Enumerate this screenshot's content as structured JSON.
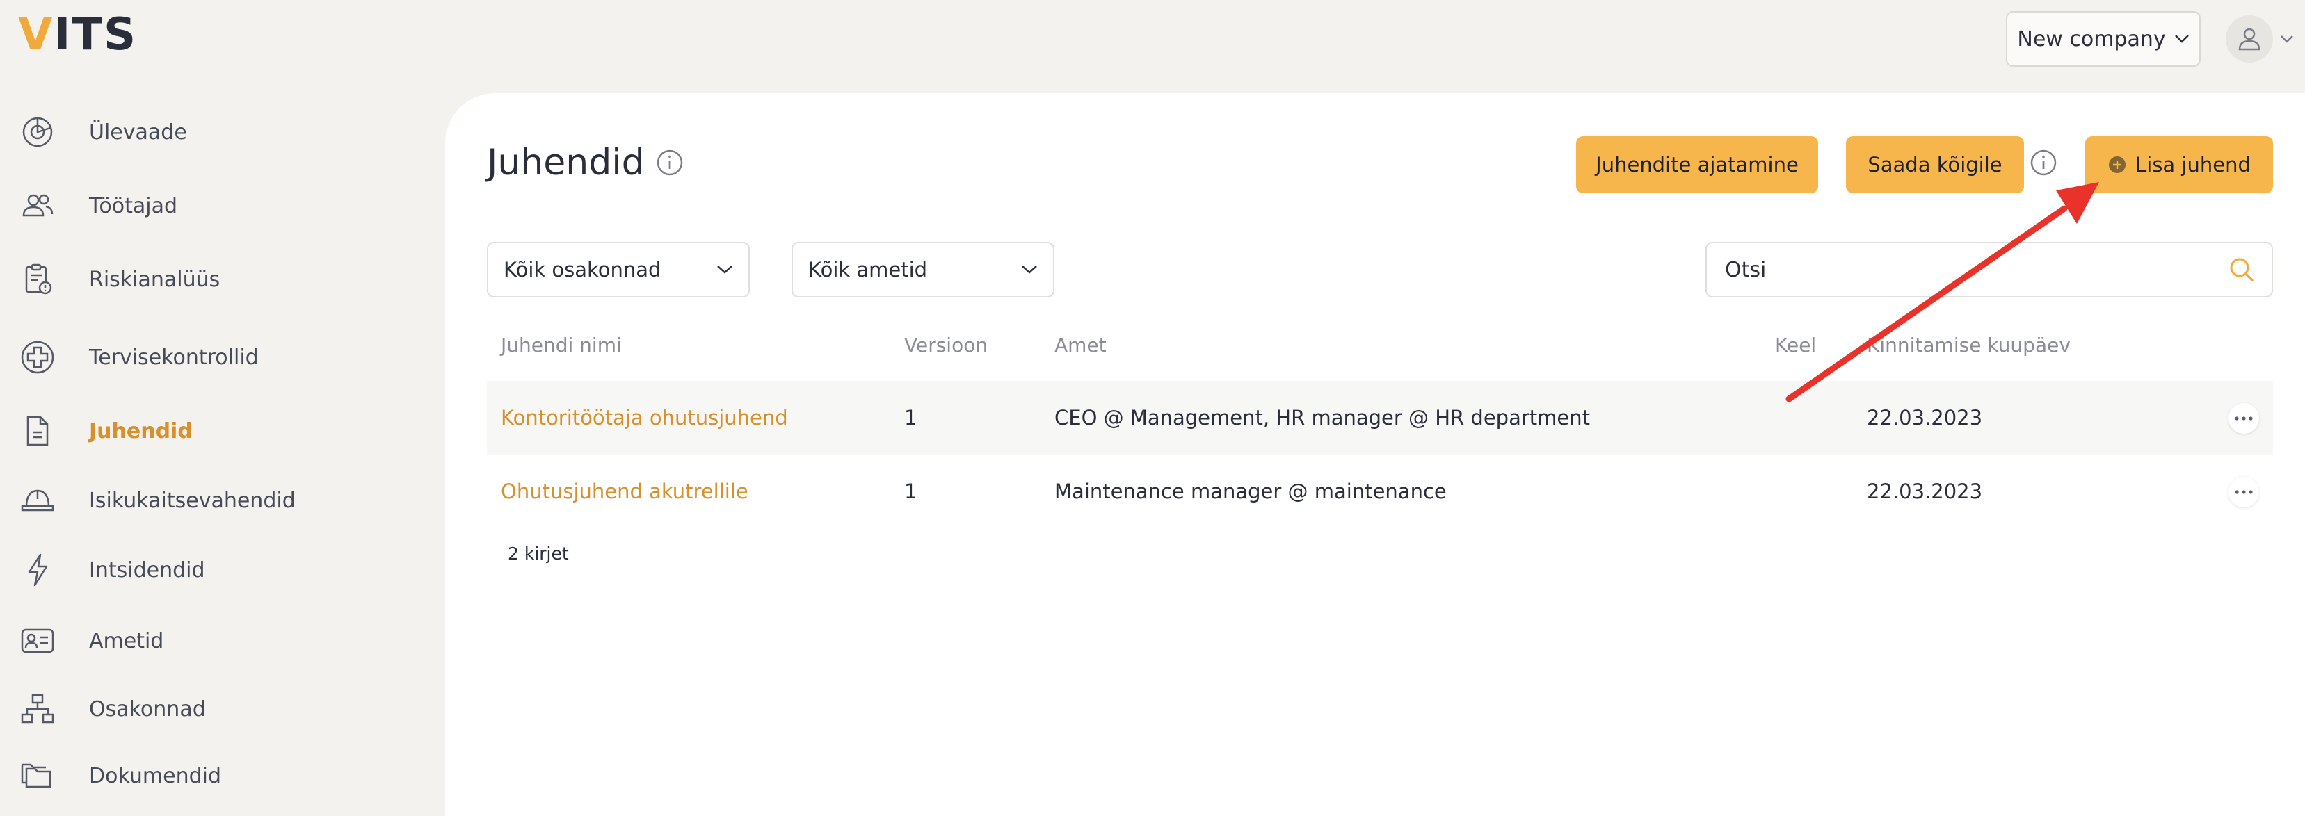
{
  "logo": {
    "accent": "V",
    "rest": "ITS"
  },
  "header": {
    "company": "New company"
  },
  "sidebar": {
    "items": [
      {
        "label": "Ülevaade",
        "icon": "chart-pie-icon"
      },
      {
        "label": "Töötajad",
        "icon": "users-icon"
      },
      {
        "label": "Riskianalüüs",
        "icon": "clipboard-alert-icon"
      },
      {
        "label": "Tervisekontrollid",
        "icon": "medical-cross-icon"
      },
      {
        "label": "Juhendid",
        "icon": "document-icon",
        "active": true
      },
      {
        "label": "Isikukaitsevahendid",
        "icon": "hard-hat-icon"
      },
      {
        "label": "Intsidendid",
        "icon": "lightning-icon"
      },
      {
        "label": "Ametid",
        "icon": "id-card-icon"
      },
      {
        "label": "Osakonnad",
        "icon": "org-chart-icon"
      },
      {
        "label": "Dokumendid",
        "icon": "folders-icon"
      }
    ]
  },
  "main": {
    "title": "Juhendid",
    "buttons": {
      "schedule": "Juhendite ajatamine",
      "send_all": "Saada kõigile",
      "add": "Lisa juhend"
    },
    "filters": {
      "departments": "Kõik osakonnad",
      "positions": "Kõik ametid"
    },
    "search": {
      "placeholder": "Otsi"
    },
    "table": {
      "headers": [
        "Juhendi nimi",
        "Versioon",
        "Amet",
        "Keel",
        "Kinnitamise kuupäev"
      ],
      "rows": [
        {
          "name": "Kontoritöötaja ohutusjuhend",
          "version": "1",
          "position": "CEO @ Management, HR manager @ HR department",
          "language": "",
          "date": "22.03.2023"
        },
        {
          "name": "Ohutusjuhend akutrellile",
          "version": "1",
          "position": "Maintenance manager @ maintenance",
          "language": "",
          "date": "22.03.2023"
        }
      ],
      "count": "2 kirjet"
    }
  },
  "colors": {
    "accent": "#f6b64b",
    "link": "#d8902c",
    "annotation_arrow": "#e8322a"
  }
}
